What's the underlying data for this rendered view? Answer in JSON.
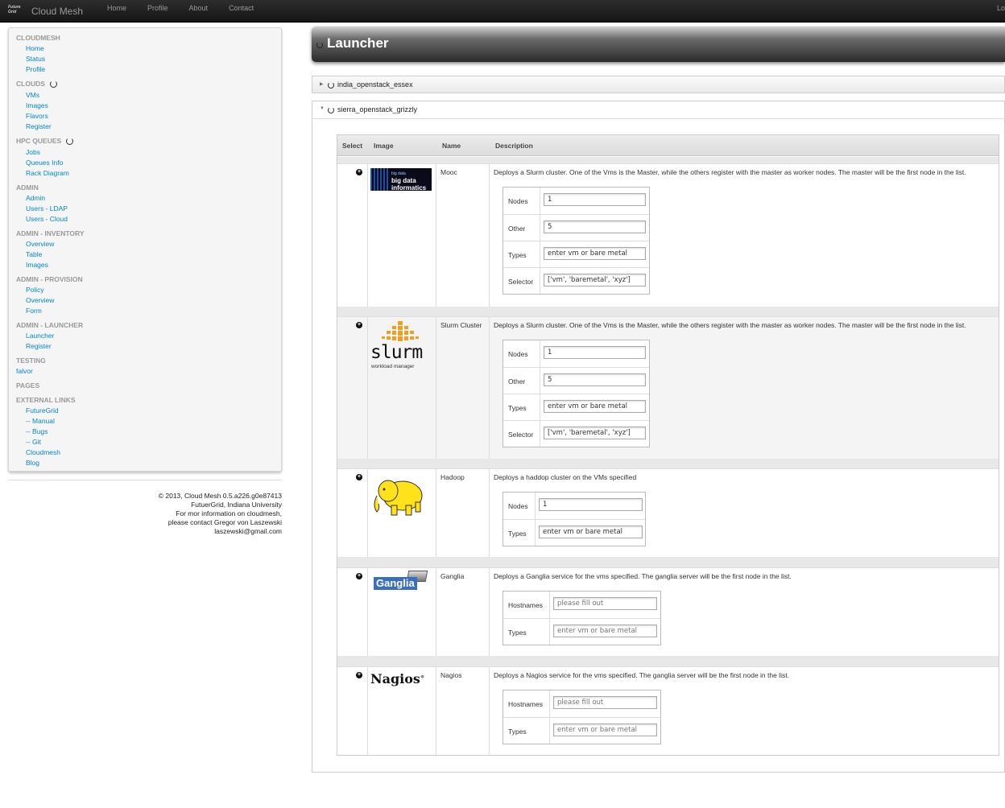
{
  "topbar": {
    "logo_text": "Future Grid",
    "brand": "Cloud Mesh",
    "nav": [
      "Home",
      "Profile",
      "About",
      "Contact"
    ],
    "right": "Lo"
  },
  "sidebar": {
    "sections": [
      {
        "title": "CLOUDMESH",
        "links": [
          "Home",
          "Status",
          "Profile"
        ]
      },
      {
        "title": "CLOUDS",
        "links": [
          "VMs",
          "Images",
          "Flavors",
          "Register"
        ]
      },
      {
        "title": "HPC QUEUES",
        "links": [
          "Jobs",
          "Queues Info",
          "Rack Diagram"
        ]
      },
      {
        "title": "ADMIN",
        "links": [
          "Admin",
          "Users - LDAP",
          "Users - Cloud"
        ]
      },
      {
        "title": "ADMIN - INVENTORY",
        "links": [
          "Overview",
          "Table",
          "Images"
        ]
      },
      {
        "title": "ADMIN - PROVISION",
        "links": [
          "Policy",
          "Overview",
          "Form"
        ]
      },
      {
        "title": "ADMIN - LAUNCHER",
        "links": [
          "Launcher",
          "Register"
        ]
      },
      {
        "title": "TESTING",
        "links": [
          "falvor"
        ]
      },
      {
        "title": "PAGES",
        "links": []
      },
      {
        "title": "EXTERNAL LINKS",
        "links": [
          "FutureGrid",
          "-- Manual",
          "-- Bugs",
          "-- Git",
          "Cloudmesh",
          "Blog"
        ]
      }
    ]
  },
  "footer": {
    "lines": [
      "© 2013, Cloud Mesh 0.5.a226.g0e87413",
      "FutuerGrid, Indiana University",
      "For mor information on cloudmesh,",
      "please contact Gregor von Laszewski",
      "laszewski@gmail.com"
    ]
  },
  "page": {
    "title": "Launcher"
  },
  "accordions": [
    "india_openstack_essex",
    "sierra_openstack_grizzly"
  ],
  "table": {
    "headers": [
      "Select",
      "Image",
      "Name",
      "Description"
    ],
    "rows": [
      {
        "name": "Mooc",
        "image_label": "big data informatics",
        "description": "Deploys a Slurm cluster. One of the Vms is the Master, while the others register with the master as worker nodes. The master will be the first node in the list.",
        "fields": [
          {
            "label": "Nodes",
            "value": "1"
          },
          {
            "label": "Other",
            "value": "5"
          },
          {
            "label": "Types",
            "value": "enter vm or bare metal"
          },
          {
            "label": "Selector",
            "value": "['vm', 'baremetal', 'xyz']"
          }
        ]
      },
      {
        "name": "Slurm Cluster",
        "image_label": "slurm",
        "image_sublabel": "workload manager",
        "description": "Deploys a Slurm cluster. One of the Vms is the Master, while the others register with the master as worker nodes. The master will be the first node in the list.",
        "fields": [
          {
            "label": "Nodes",
            "value": "1"
          },
          {
            "label": "Other",
            "value": "5"
          },
          {
            "label": "Types",
            "value": "enter vm or bare metal"
          },
          {
            "label": "Selector",
            "value": "['vm', 'baremetal', 'xyz']"
          }
        ]
      },
      {
        "name": "Hadoop",
        "image_label": "hadoop elephant",
        "description": "Deploys a haddop cluster on the VMs specified",
        "fields": [
          {
            "label": "Nodes",
            "value": "1"
          },
          {
            "label": "Types",
            "value": "enter vm or bare metal"
          }
        ]
      },
      {
        "name": "Ganglia",
        "image_label": "Ganglia",
        "description": "Deploys a Ganglia service for the vms specified. The ganglia server will be the first node in the list.",
        "fields": [
          {
            "label": "Hostnames",
            "value": "please fill out"
          },
          {
            "label": "Types",
            "value": "enter vm or bare metal"
          }
        ]
      },
      {
        "name": "Nagios",
        "image_label": "Nagios",
        "description": "Deploys a Nagios service for the vms specified. The ganglia server will be the first node in the list.",
        "fields": [
          {
            "label": "Hostnames",
            "value": "please fill out"
          },
          {
            "label": "Types",
            "value": "enter vm or bare metal"
          }
        ]
      }
    ]
  }
}
